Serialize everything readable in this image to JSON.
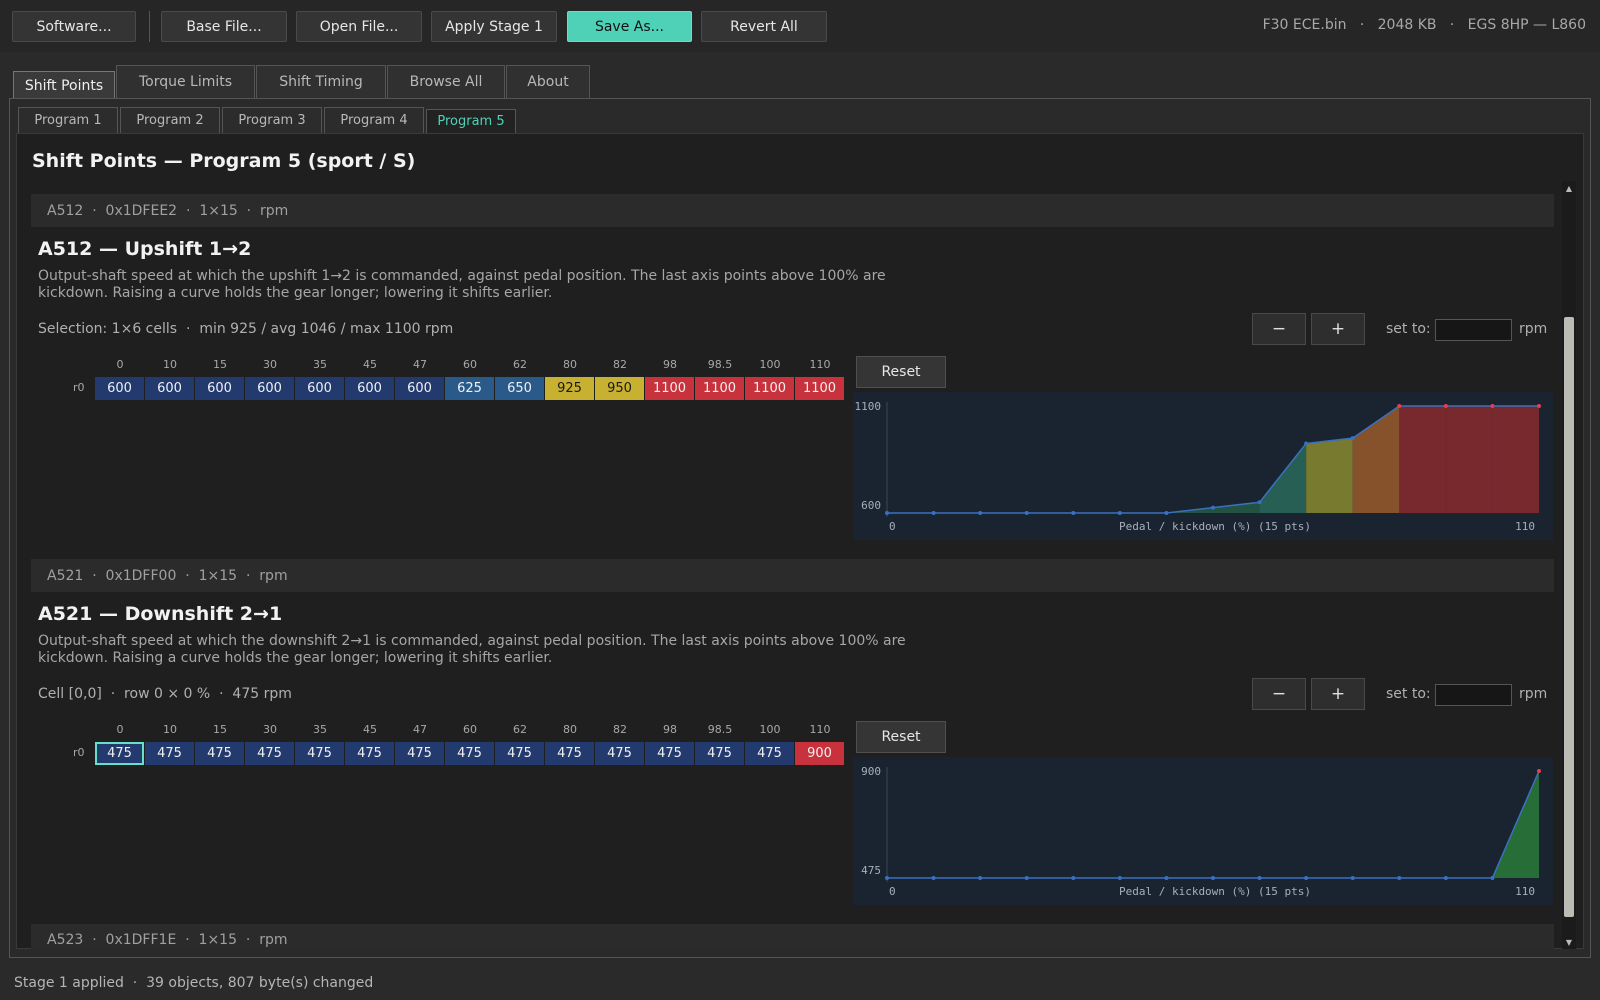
{
  "toolbar": {
    "buttons": [
      "Software...",
      "Base File...",
      "Open File...",
      "Apply Stage 1",
      "Save As...",
      "Revert All"
    ],
    "file_name": "F30 ECE.bin",
    "file_size": "2048 KB",
    "gearbox": "EGS 8HP — L860"
  },
  "main_tabs": [
    "Shift Points",
    "Torque Limits",
    "Shift Timing",
    "Browse All",
    "About"
  ],
  "sub_tabs": [
    "Program 1",
    "Program 2",
    "Program 3",
    "Program 4",
    "Program 5"
  ],
  "page_title": "Shift Points — Program 5 (sport / S)",
  "common": {
    "set_to_label": "set to:",
    "unit": "rpm",
    "reset_label": "Reset",
    "minus": "−",
    "plus": "+",
    "row_label": "r0",
    "chart_axis_label": "Pedal / kickdown (%)  (15 pts)",
    "chart_x_min": "0",
    "chart_x_max": "110"
  },
  "axis": [
    "0",
    "10",
    "15",
    "30",
    "35",
    "45",
    "47",
    "60",
    "62",
    "80",
    "82",
    "98",
    "98.5",
    "100",
    "110"
  ],
  "maps": [
    {
      "header": "A512  ·  0x1DFEE2  ·  1×15  ·  rpm",
      "title": "A512 — Upshift 1→2",
      "description": "Output-shaft speed at which the upshift 1→2 is commanded, against pedal position. The last axis points above 100% are kickdown. Raising a curve holds the gear longer; lowering it shifts earlier.",
      "status": "Selection: 1×6 cells  ·  min 925 / avg 1046 / max 1100 rpm",
      "values": [
        "600",
        "600",
        "600",
        "600",
        "600",
        "600",
        "600",
        "625",
        "650",
        "925",
        "950",
        "1100",
        "1100",
        "1100",
        "1100"
      ],
      "y_min_label": "600",
      "y_max_label": "1100"
    },
    {
      "header": "A521  ·  0x1DFF00  ·  1×15  ·  rpm",
      "title": "A521 — Downshift 2→1",
      "description": "Output-shaft speed at which the downshift 2→1 is commanded, against pedal position. The last axis points above 100% are kickdown. Raising a curve holds the gear longer; lowering it shifts earlier.",
      "status": "Cell [0,0]  ·  row 0 × 0 %  ·  475 rpm",
      "values": [
        "475",
        "475",
        "475",
        "475",
        "475",
        "475",
        "475",
        "475",
        "475",
        "475",
        "475",
        "475",
        "475",
        "475",
        "900"
      ],
      "y_min_label": "475",
      "y_max_label": "900"
    }
  ],
  "next_map_header": "A523  ·  0x1DFF1E  ·  1×15  ·  rpm",
  "statusbar": "Stage 1 applied  ·  39 objects, 807 byte(s) changed",
  "colors": {
    "accent": "#4fd1b8",
    "cell_low": "#233a6e",
    "cell_mid": "#2a5a8a",
    "cell_warm": "#a8b84a",
    "cell_yellow": "#c8b030",
    "cell_high": "#c8323c"
  },
  "icons": {
    "scroll_up": "triangle-up-icon",
    "scroll_down": "triangle-down-icon"
  }
}
